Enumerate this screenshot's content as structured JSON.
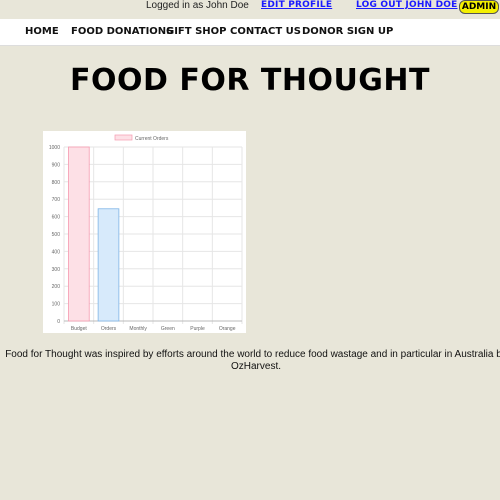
{
  "header": {
    "logged_in_text": "Logged in as John Doe",
    "edit_profile": "EDIT PROFILE",
    "logout": "LOG OUT JOHN DOE",
    "admin": "ADMIN"
  },
  "nav": {
    "home": "HOME",
    "food_donations": "FOOD DONATIONS",
    "gift_shop": "GIFT SHOP",
    "contact_us": "CONTACT US",
    "donor_sign_up": "DONOR SIGN UP"
  },
  "page": {
    "title": "FOOD FOR THOUGHT",
    "description": "Food for Thought was inspired by efforts around the world to reduce food wastage and in particular in Australia by OzHarvest."
  },
  "colors": {
    "background": "#e8e6d9",
    "link": "#1a1aff",
    "admin_button": "#f4f000",
    "bar_pink_fill": "#fde0e6",
    "bar_pink_stroke": "#f59ab0",
    "bar_blue_fill": "#d7eafb",
    "bar_blue_stroke": "#7fb5e6"
  },
  "chart_data": {
    "type": "bar",
    "categories": [
      "Budget",
      "Orders",
      "Monthly",
      "Green",
      "Purple",
      "Orange"
    ],
    "series": [
      {
        "name": "Current Orders",
        "values": [
          1000,
          645,
          0,
          0,
          0,
          0
        ]
      }
    ],
    "ylim": [
      0,
      1000
    ],
    "yticks": [
      0,
      100,
      200,
      300,
      400,
      500,
      600,
      700,
      800,
      900,
      1000
    ],
    "grid": true,
    "legend": "top-center"
  }
}
